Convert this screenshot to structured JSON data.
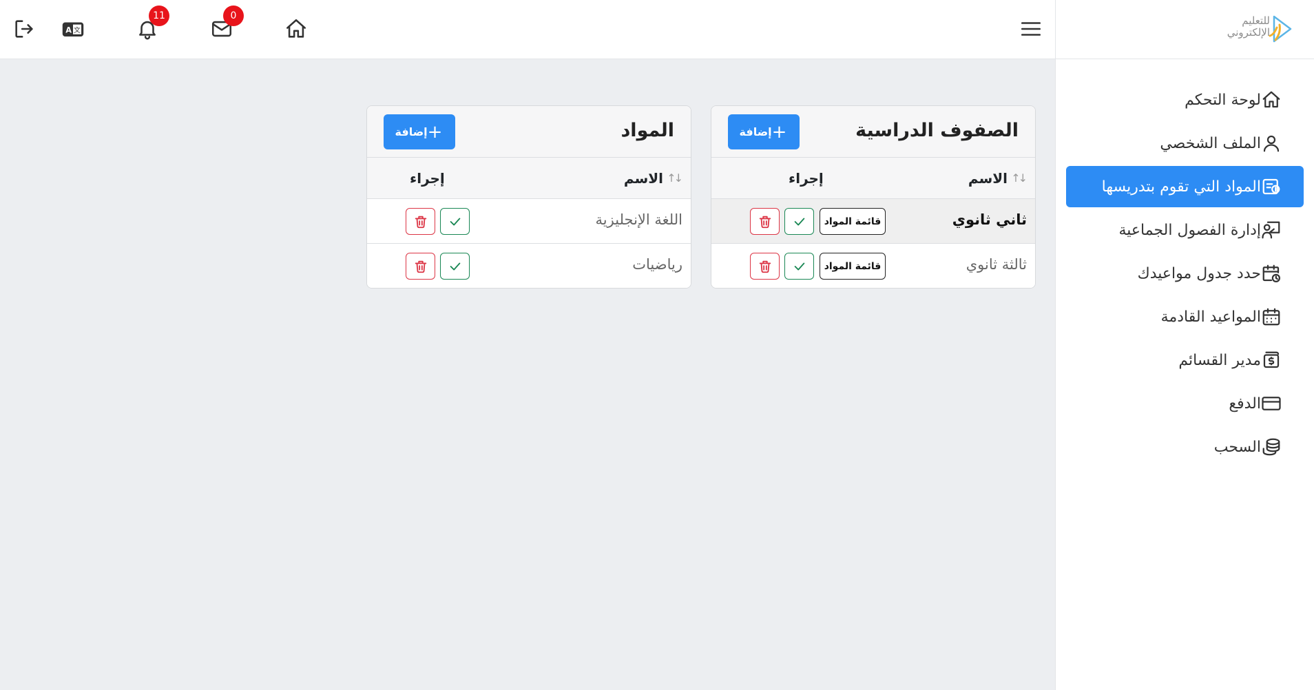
{
  "topbar": {
    "notifications_count": "11",
    "messages_count": "0"
  },
  "logo": {
    "line1": "للتعليم",
    "line2": "الإلكتروني"
  },
  "sidebar": {
    "items": [
      {
        "label": "لوحة التحكم",
        "icon": "home-icon",
        "active": false
      },
      {
        "label": "الملف الشخصي",
        "icon": "user-icon",
        "active": false
      },
      {
        "label": "المواد التي تقوم بتدريسها",
        "icon": "book-money-icon",
        "active": true
      },
      {
        "label": "إدارة الفصول الجماعية",
        "icon": "presentation-icon",
        "active": false
      },
      {
        "label": "حدد جدول مواعيدك",
        "icon": "calendar-clock-icon",
        "active": false
      },
      {
        "label": "المواعيد القادمة",
        "icon": "calendar-icon",
        "active": false
      },
      {
        "label": "مدير القسائم",
        "icon": "voucher-icon",
        "active": false
      },
      {
        "label": "الدفع",
        "icon": "credit-card-icon",
        "active": false
      },
      {
        "label": "السحب",
        "icon": "coins-icon",
        "active": false
      }
    ]
  },
  "grades": {
    "title": "الصفوف الدراسية",
    "add_label": "إضافة",
    "col_name": "الاسم",
    "col_action": "إجراء",
    "list_label": "قائمة المواد",
    "rows": [
      {
        "name": "ثاني ثانوي"
      },
      {
        "name": "ثالثة ثانوي"
      }
    ]
  },
  "subjects": {
    "title": "المواد",
    "add_label": "إضافة",
    "col_name": "الاسم",
    "col_action": "إجراء",
    "rows": [
      {
        "name": "اللغة الإنجليزية"
      },
      {
        "name": "رياضيات"
      }
    ]
  },
  "colors": {
    "accent": "#2d8cf4",
    "danger": "#dc3545",
    "success": "#198754",
    "badge": "#e8141b"
  }
}
